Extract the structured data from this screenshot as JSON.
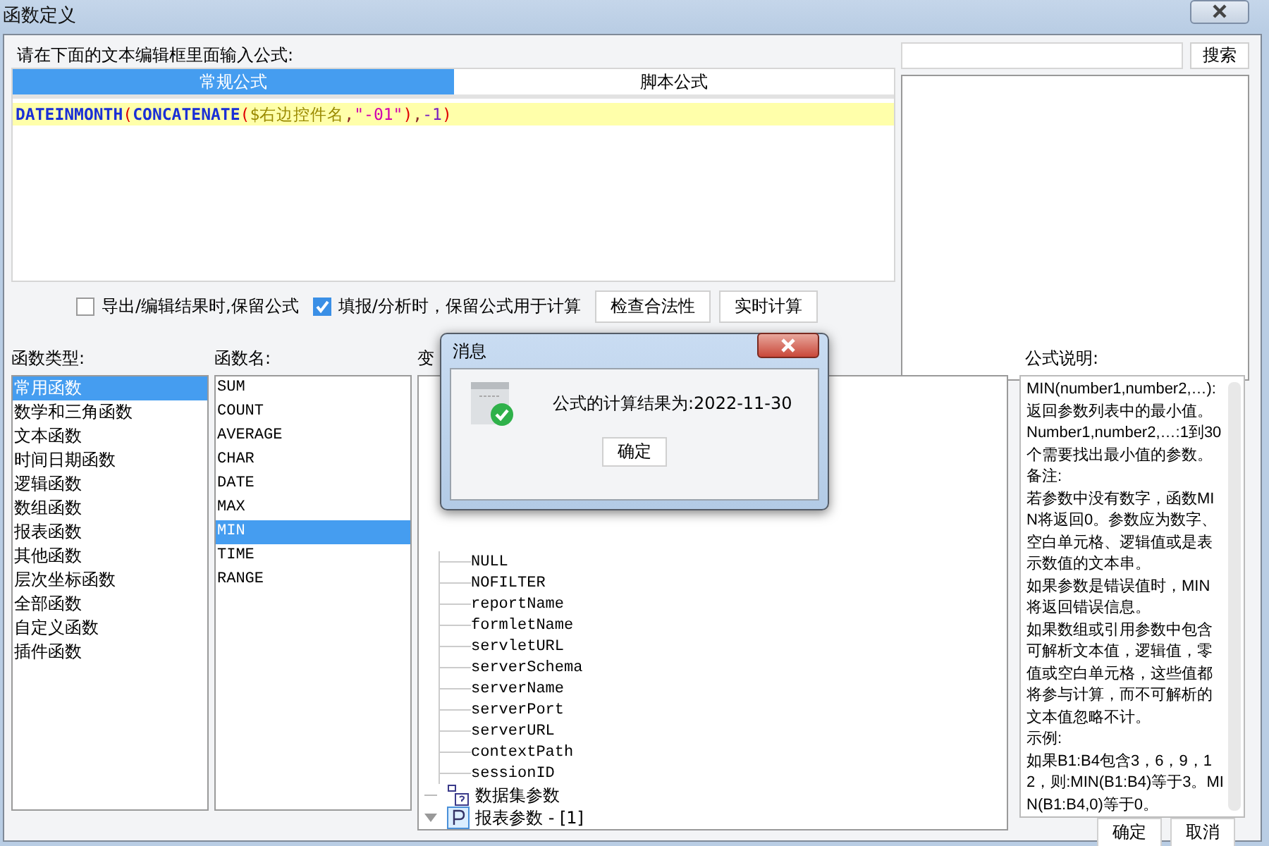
{
  "window": {
    "title": "函数定义"
  },
  "editor": {
    "prompt": "请在下面的文本编辑框里面输入公式:",
    "tabs": [
      {
        "label": "常规公式",
        "selected": true
      },
      {
        "label": "脚本公式",
        "selected": false
      }
    ],
    "formula": [
      {
        "kind": "function",
        "text": "DATEINMONTH"
      },
      {
        "kind": "paren",
        "text": "("
      },
      {
        "kind": "function",
        "text": "CONCATENATE"
      },
      {
        "kind": "paren",
        "text": "("
      },
      {
        "kind": "variable",
        "text": "$右边控件名"
      },
      {
        "kind": "punct",
        "text": ","
      },
      {
        "kind": "string",
        "text": "\"-01\""
      },
      {
        "kind": "paren",
        "text": ")"
      },
      {
        "kind": "punct",
        "text": ","
      },
      {
        "kind": "number",
        "text": "-1"
      },
      {
        "kind": "paren",
        "text": ")"
      }
    ]
  },
  "options": [
    {
      "label": "导出/编辑结果时,保留公式",
      "checked": false
    },
    {
      "label": "填报/分析时，保留公式用于计算",
      "checked": true
    }
  ],
  "action_buttons": [
    "检查合法性",
    "实时计算"
  ],
  "search": {
    "button": "搜索"
  },
  "function_types": {
    "label": "函数类型:",
    "items": [
      {
        "label": "常用函数",
        "selected": true
      },
      {
        "label": "数学和三角函数",
        "selected": false
      },
      {
        "label": "文本函数",
        "selected": false
      },
      {
        "label": "时间日期函数",
        "selected": false
      },
      {
        "label": "逻辑函数",
        "selected": false
      },
      {
        "label": "数组函数",
        "selected": false
      },
      {
        "label": "报表函数",
        "selected": false
      },
      {
        "label": "其他函数",
        "selected": false
      },
      {
        "label": "层次坐标函数",
        "selected": false
      },
      {
        "label": "全部函数",
        "selected": false
      },
      {
        "label": "自定义函数",
        "selected": false
      },
      {
        "label": "插件函数",
        "selected": false
      }
    ]
  },
  "function_names": {
    "label": "函数名:",
    "items": [
      {
        "label": "SUM",
        "selected": false
      },
      {
        "label": "COUNT",
        "selected": false
      },
      {
        "label": "AVERAGE",
        "selected": false
      },
      {
        "label": "CHAR",
        "selected": false
      },
      {
        "label": "DATE",
        "selected": false
      },
      {
        "label": "MAX",
        "selected": false
      },
      {
        "label": "MIN",
        "selected": true
      },
      {
        "label": "TIME",
        "selected": false
      },
      {
        "label": "RANGE",
        "selected": false
      }
    ]
  },
  "variables": {
    "label": "变",
    "tree": [
      {
        "label": "NULL"
      },
      {
        "label": "NOFILTER"
      },
      {
        "label": "reportName"
      },
      {
        "label": "formletName"
      },
      {
        "label": "servletURL"
      },
      {
        "label": "serverSchema"
      },
      {
        "label": "serverName"
      },
      {
        "label": "serverPort"
      },
      {
        "label": "serverURL"
      },
      {
        "label": "contextPath"
      },
      {
        "label": "sessionID"
      }
    ],
    "groups": [
      {
        "label": "数据集参数",
        "kind": "dataset",
        "expanded": false
      },
      {
        "label": "报表参数 - [1]",
        "kind": "param",
        "expanded": true
      }
    ]
  },
  "description": {
    "label": "公式说明:",
    "paragraphs": [
      "MIN(number1,number2,…):返回参数列表中的最小值。",
      "Number1,number2,…:1到30个需要找出最小值的参数。",
      "备注:",
      "若参数中没有数字，函数MIN将返回0。参数应为数字、空白单元格、逻辑值或是表示数值的文本串。",
      "如果参数是错误值时，MIN将返回错误信息。",
      "如果数组或引用参数中包含可解析文本值，逻辑值，零值或空白单元格，这些值都将参与计算，而不可解析的文本值忽略不计。",
      "示例:",
      "如果B1:B4包含3，6，9，12，则:MIN(B1:B4)等于3。MIN(B1:B4,0)等于0。"
    ]
  },
  "footer_buttons": [
    "确定",
    "取消"
  ],
  "message_dialog": {
    "title": "消息",
    "text": "公式的计算结果为:2022-11-30",
    "button": "确定"
  }
}
